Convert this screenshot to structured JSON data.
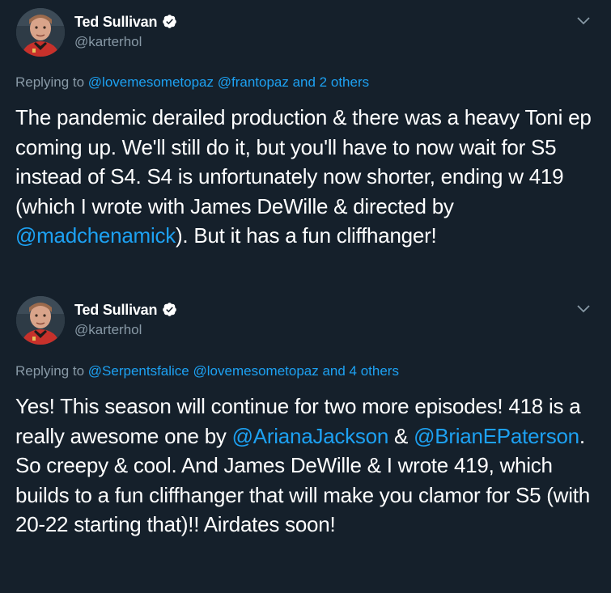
{
  "tweets": [
    {
      "author_name": "Ted Sullivan",
      "author_handle": "@karterhol",
      "reply_prefix": "Replying to ",
      "reply_user1": "@lovemesometopaz",
      "reply_space": " ",
      "reply_user2": "@frantopaz",
      "reply_suffix": " and 2 others",
      "text_part1": "The pandemic derailed production & there was a heavy Toni ep coming up. We'll still do it, but you'll have to now wait for S5 instead of S4. S4 is unfortunately now shorter, ending w 419 (which I wrote with James DeWille & directed by ",
      "mention1": "@madchenamick",
      "text_part2": "). But it has a fun cliffhanger!"
    },
    {
      "author_name": "Ted Sullivan",
      "author_handle": "@karterhol",
      "reply_prefix": "Replying to ",
      "reply_user1": "@Serpentsfalice",
      "reply_space": " ",
      "reply_user2": "@lovemesometopaz",
      "reply_suffix": " and 4 others",
      "text_part1": "Yes! This season will continue for two more episodes! 418 is a really awesome one by ",
      "mention1": "@ArianaJackson",
      "text_mid": " & ",
      "mention2": "@BrianEPaterson",
      "text_part2": ". So creepy & cool. And James DeWille & I wrote 419, which builds to a fun cliffhanger that will make you clamor for S5 (with 20-22 starting that)!! Airdates soon!"
    }
  ],
  "colors": {
    "background": "#15202b",
    "link": "#1da1f2",
    "muted": "#8899a6",
    "verified": "#ffffff"
  },
  "icons": {
    "verified": "verified-badge-icon",
    "caret": "chevron-down-icon"
  }
}
